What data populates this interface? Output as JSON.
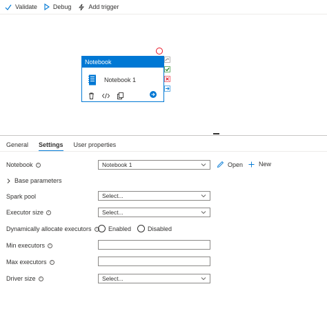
{
  "toolbar": {
    "validate_label": "Validate",
    "debug_label": "Debug",
    "add_trigger_label": "Add trigger"
  },
  "activity": {
    "type_label": "Notebook",
    "name": "Notebook 1"
  },
  "tabs": [
    {
      "label": "General"
    },
    {
      "label": "Settings",
      "active": true
    },
    {
      "label": "User properties"
    }
  ],
  "settings": {
    "notebook_label": "Notebook",
    "notebook_value": "Notebook 1",
    "open_label": "Open",
    "new_label": "New",
    "base_parameters_label": "Base parameters",
    "spark_pool_label": "Spark pool",
    "spark_pool_value": "Select...",
    "executor_size_label": "Executor size",
    "executor_size_value": "Select...",
    "dyn_alloc_label": "Dynamically allocate executors",
    "enabled_label": "Enabled",
    "disabled_label": "Disabled",
    "min_executors_label": "Min executors",
    "max_executors_label": "Max executors",
    "driver_size_label": "Driver size",
    "driver_size_value": "Select..."
  },
  "colors": {
    "accent": "#0078d4",
    "success": "#107c10",
    "error": "#e81123"
  }
}
